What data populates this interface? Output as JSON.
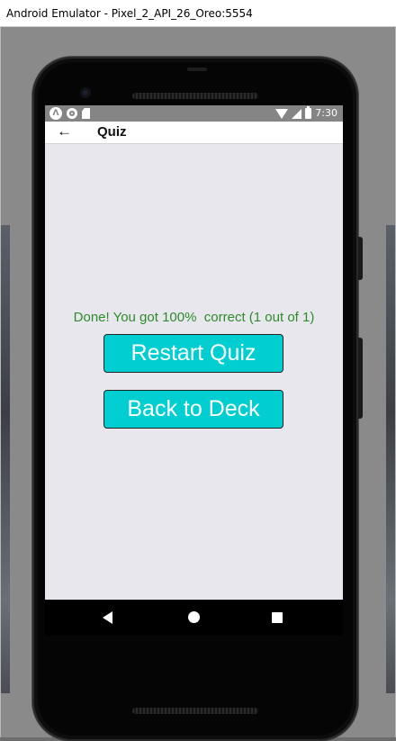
{
  "window": {
    "title": "Android Emulator - Pixel_2_API_26_Oreo:5554"
  },
  "status_bar": {
    "time": "7:30",
    "left_icons": [
      "android-studio-icon",
      "record-icon",
      "sd-card-icon"
    ],
    "right_icons": [
      "wifi-icon",
      "cellular-signal-icon",
      "battery-icon"
    ]
  },
  "app_bar": {
    "back_icon": "arrow-back-icon",
    "title": "Quiz"
  },
  "quiz_result": {
    "message": "Done! You got 100%  correct (1 out of 1)",
    "percent": 100,
    "correct": 1,
    "total": 1
  },
  "buttons": {
    "restart_label": "Restart Quiz",
    "back_label": "Back to Deck"
  },
  "nav_bar": {
    "icons": [
      "nav-back-icon",
      "nav-home-icon",
      "nav-recents-icon"
    ]
  },
  "colors": {
    "button_bg": "#00ced1",
    "result_text": "#2e8b2a",
    "screen_bg": "#e9e7ee",
    "status_bar": "#858585"
  }
}
